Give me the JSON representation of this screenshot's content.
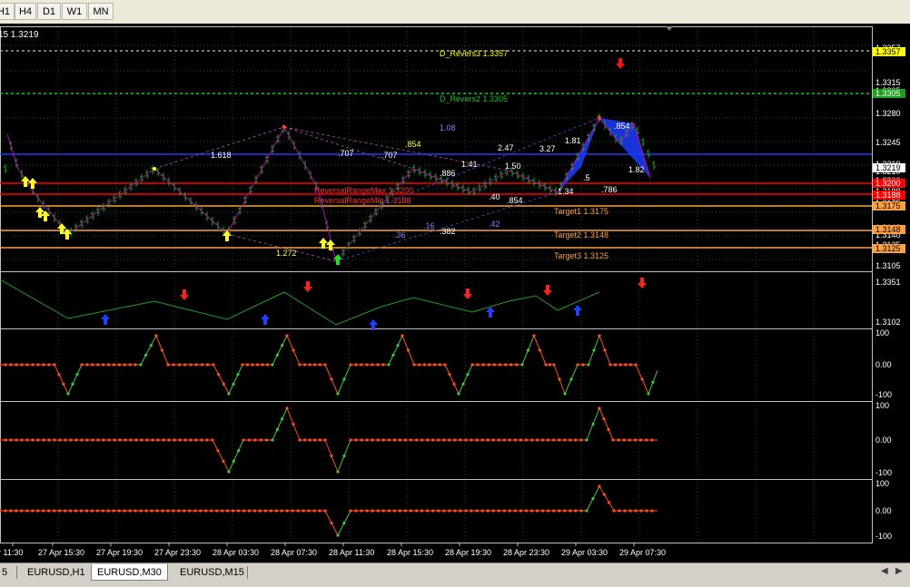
{
  "toolbar": {
    "timeframes": [
      "H1",
      "H4",
      "D1",
      "W1",
      "MN"
    ]
  },
  "chart": {
    "symbol_label": "15 1.3219",
    "colors": {
      "background": "#000000",
      "grid": "#2e4a2e",
      "bar_up": "#00b400",
      "bar_down": "#00b400",
      "zigzag": "#c000c0",
      "resistance": "#ff0000",
      "target": "#ffa040",
      "pattern_fill": "#1e3cff",
      "indicator_up": "#40c840",
      "indicator_down": "#ff5020"
    },
    "price_axis": {
      "labels": [
        "1.3357",
        "1.3315",
        "1.3305",
        "1.3280",
        "1.3245",
        "1.3210",
        "1.3219",
        "1.3200",
        "1.3188",
        "1.3175",
        "1.3148",
        "1.3140",
        "1.3125",
        "1.3105"
      ],
      "badges": [
        {
          "text": "1.3357",
          "bg": "#ffff00",
          "fg": "#000000"
        },
        {
          "text": "1.3305",
          "bg": "#20a020",
          "fg": "#ffffff"
        },
        {
          "text": "1.3219",
          "bg": "#ffffff",
          "fg": "#000000"
        },
        {
          "text": "1.3200",
          "bg": "#ff0000",
          "fg": "#ffffff"
        },
        {
          "text": "1.3188",
          "bg": "#ff0000",
          "fg": "#ffffff"
        },
        {
          "text": "1.3175",
          "bg": "#ffa040",
          "fg": "#000000"
        },
        {
          "text": "1.3148",
          "bg": "#ffa040",
          "fg": "#000000"
        },
        {
          "text": "1.3125",
          "bg": "#ffa040",
          "fg": "#000000"
        }
      ]
    },
    "levels": [
      {
        "label": "D_Revers3 1.3357",
        "color": "#ffff00"
      },
      {
        "label": "D_Revers2 1.3305",
        "color": "#20c020"
      },
      {
        "label": "ReversalRangeMax 1.3200",
        "color": "#ff3030"
      },
      {
        "label": "ReversalRangeMin 1.3188",
        "color": "#ff3030"
      },
      {
        "label": "Target1 1.3175",
        "color": "#ffa040"
      },
      {
        "label": "Target2 1.3148",
        "color": "#ffa040"
      },
      {
        "label": "Target3 1.3125",
        "color": "#ffa040"
      }
    ],
    "fib_labels": [
      "1.618",
      "1.08",
      ".707",
      ".707",
      ".854",
      ".886",
      "1.41",
      "2.47",
      "3.27",
      "1.81",
      ".854",
      "1.50",
      ".40",
      ".854",
      "1.34",
      ".5",
      ".786",
      ".16",
      ".42",
      ".36",
      ".382",
      "1.272",
      "1.82"
    ],
    "subwindow1": {
      "labels": [
        "1.3351",
        "1.3102"
      ]
    },
    "oscillators": {
      "labels": [
        "100",
        "0.00",
        "-100"
      ]
    },
    "time_axis": [
      "r 11:30",
      "27 Apr 15:30",
      "27 Apr 19:30",
      "27 Apr 23:30",
      "28 Apr 03:30",
      "28 Apr 07:30",
      "28 Apr 11:30",
      "28 Apr 15:30",
      "28 Apr 19:30",
      "28 Apr 23:30",
      "29 Apr 03:30",
      "29 Apr 07:30"
    ]
  },
  "tabs": {
    "items": [
      "5",
      "EURUSD,H1",
      "EURUSD,M30",
      "EURUSD,M15"
    ],
    "active_index": 2
  }
}
